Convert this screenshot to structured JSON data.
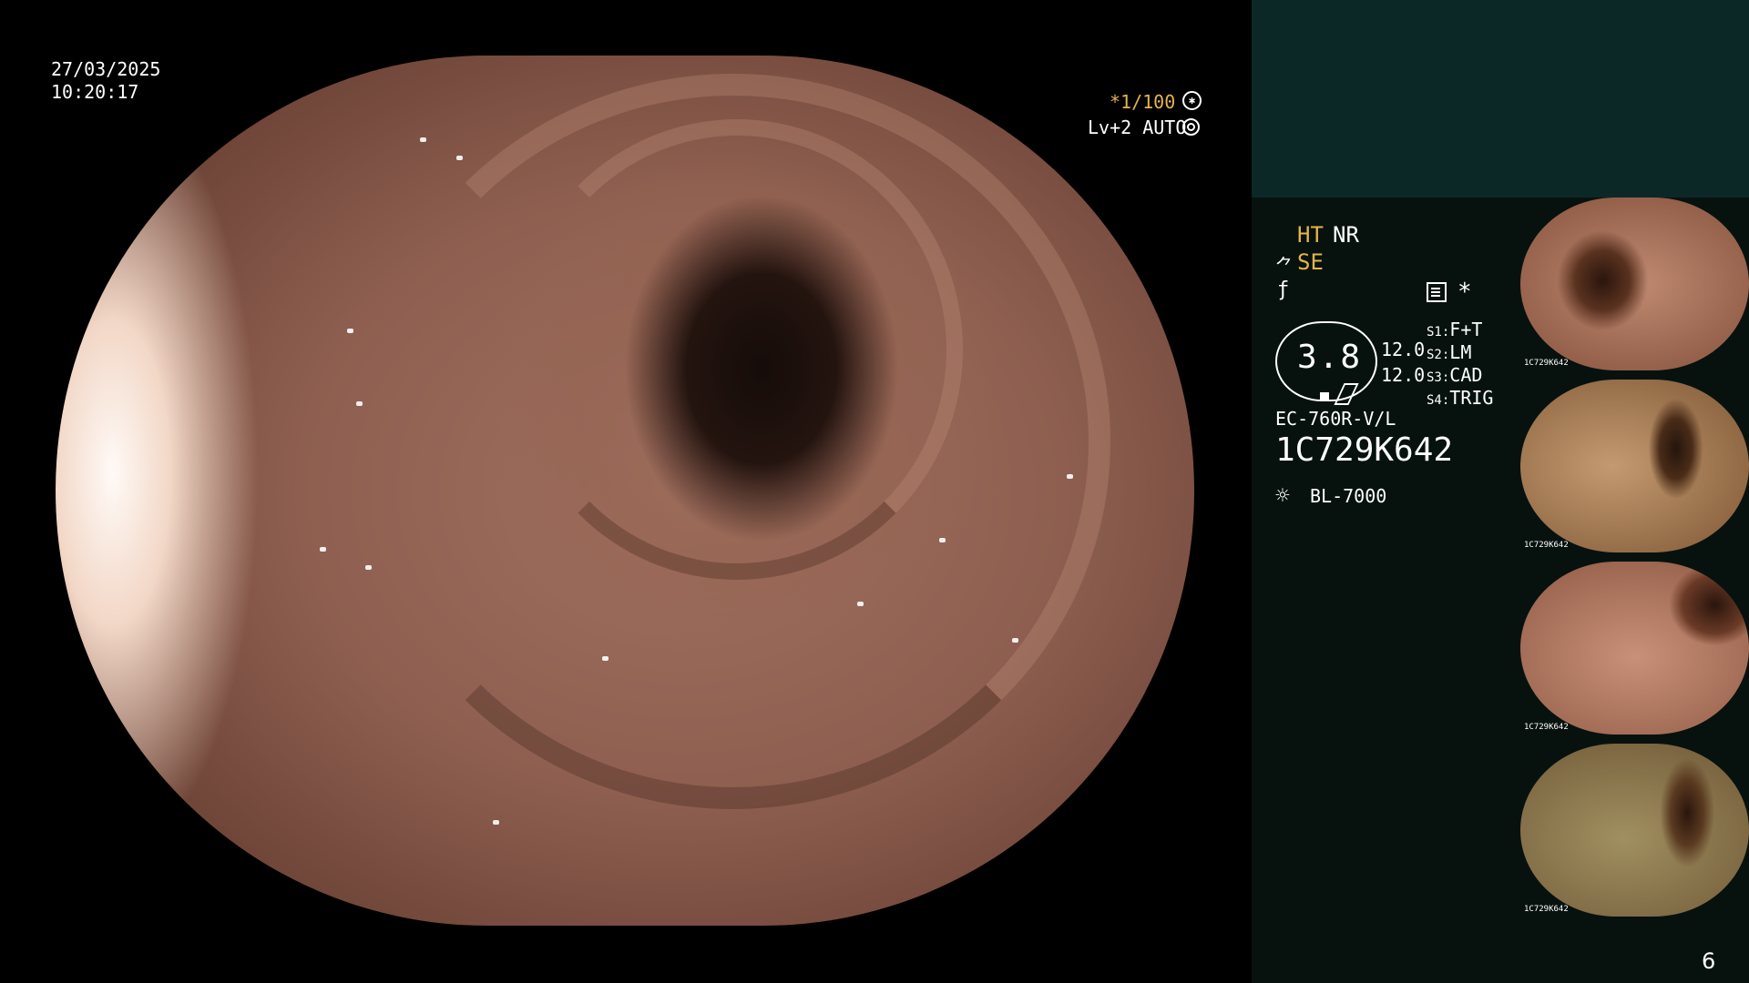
{
  "overlay": {
    "date": "27/03/2025",
    "time": "10:20:17",
    "shutter": "*1/100",
    "level": "Lv+2 AUTO"
  },
  "panel": {
    "ht": "HT",
    "nr": "NR",
    "se": "SE",
    "star": "*",
    "gauge_value": "3.8",
    "value_1": "12.0",
    "value_2": "12.0",
    "settings": [
      {
        "label": "S1",
        "value": "F+T"
      },
      {
        "label": "S2",
        "value": "LM"
      },
      {
        "label": "S3",
        "value": "CAD"
      },
      {
        "label": "S4",
        "value": "TRIG"
      }
    ],
    "scope_model": "EC-760R-V/L",
    "serial": "1C729K642",
    "light_source": "BL-7000"
  },
  "thumbnails": [
    {
      "caption": "1C729K642",
      "index": "1"
    },
    {
      "caption": "1C729K642",
      "index": "4"
    },
    {
      "caption": "1C729K642",
      "index": "3"
    },
    {
      "caption": "1C729K642",
      "index": "2"
    }
  ],
  "page_number": "6",
  "colors": {
    "accent_yellow": "#e4b54a",
    "panel_top": "#0b2826",
    "panel_bottom": "#07120f"
  }
}
